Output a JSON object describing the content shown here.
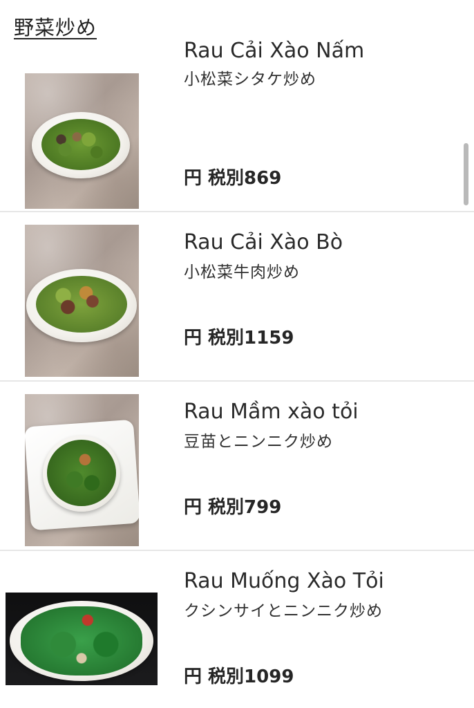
{
  "section": {
    "title": "野菜炒め"
  },
  "items": [
    {
      "name": "Rau Cải Xào Nấm",
      "japanese": "小松菜シタケ炒め",
      "price": "円 税別869",
      "photo": "stir-fried greens with mushrooms on round white plate"
    },
    {
      "name": "Rau Cải Xào Bò",
      "japanese": "小松菜牛肉炒め",
      "price": "円 税別1159",
      "photo": "stir-fried greens with beef on round white plate"
    },
    {
      "name": "Rau Mầm xào tỏi",
      "japanese": "豆苗とニンニク炒め",
      "price": "円 税別799",
      "photo": "pea sprouts with garlic on square white plate"
    },
    {
      "name": "Rau Muống Xào Tỏi",
      "japanese": "クシンサイとニンニク炒め",
      "price": "円 税別1099",
      "photo": "water spinach with garlic on dark background"
    }
  ],
  "colors": {
    "divider": "#e6e6e6",
    "text": "#262626",
    "scrollbar": "#b9b9b9"
  }
}
